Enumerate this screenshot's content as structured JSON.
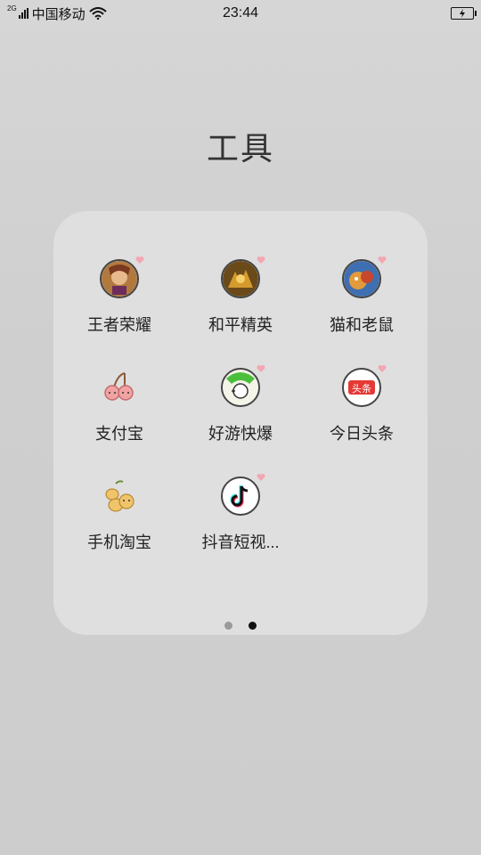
{
  "status_bar": {
    "network_type": "2G",
    "carrier": "中国移动",
    "time": "23:44",
    "icons": [
      "signal-icon",
      "wifi-icon",
      "battery-charging-icon"
    ]
  },
  "folder": {
    "title": "工具",
    "apps": [
      {
        "label": "王者荣耀",
        "icon": "honor-of-kings-icon",
        "new": true
      },
      {
        "label": "和平精英",
        "icon": "peace-elite-icon",
        "new": true
      },
      {
        "label": "猫和老鼠",
        "icon": "tom-and-jerry-icon",
        "new": true
      },
      {
        "label": "支付宝",
        "icon": "cherry-placeholder-icon",
        "new": false
      },
      {
        "label": "好游快爆",
        "icon": "haoyou-kuaibao-icon",
        "new": true
      },
      {
        "label": "今日头条",
        "icon": "toutiao-icon",
        "new": true
      },
      {
        "label": "手机淘宝",
        "icon": "loquat-placeholder-icon",
        "new": false
      },
      {
        "label": "抖音短视...",
        "icon": "douyin-icon",
        "new": true
      }
    ],
    "pages": {
      "count": 2,
      "current": 2
    }
  },
  "colors": {
    "heart": "#f3a7b2",
    "dot_active": "#111111",
    "dot_inactive": "#9a9a9a"
  }
}
